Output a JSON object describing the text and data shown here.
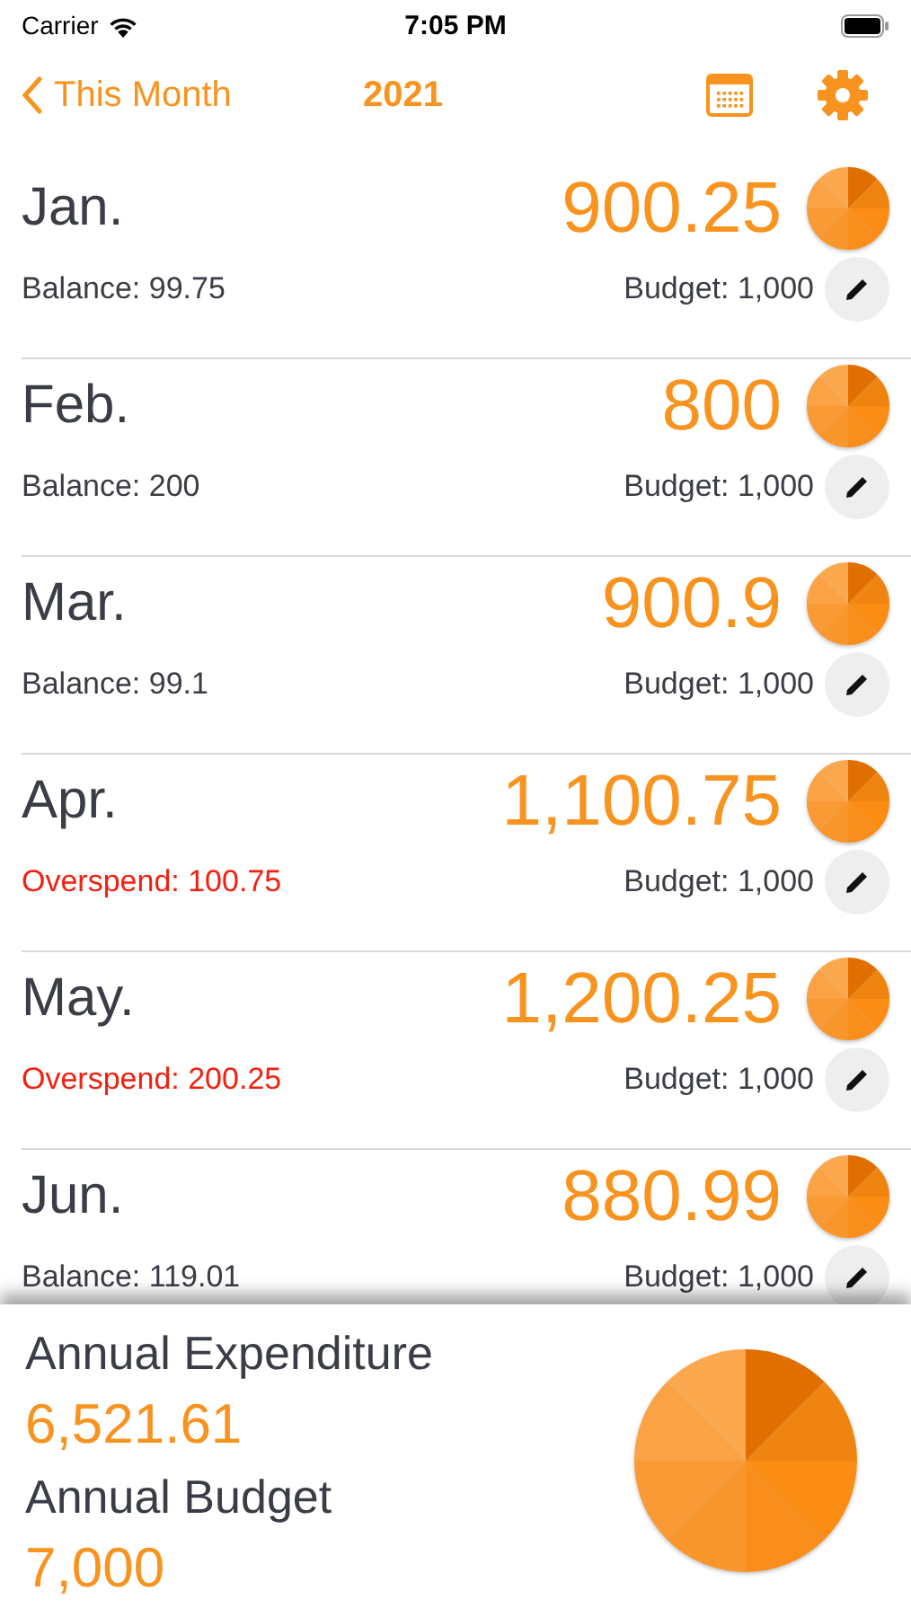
{
  "status_bar": {
    "carrier": "Carrier",
    "time": "7:05 PM"
  },
  "nav": {
    "back_label": "This Month",
    "title": "2021"
  },
  "months": [
    {
      "name": "Jan.",
      "amount": "900.25",
      "overspend": false,
      "status": "Balance: 99.75",
      "budget": "Budget: 1,000"
    },
    {
      "name": "Feb.",
      "amount": "800",
      "overspend": false,
      "status": "Balance: 200",
      "budget": "Budget: 1,000"
    },
    {
      "name": "Mar.",
      "amount": "900.9",
      "overspend": false,
      "status": "Balance: 99.1",
      "budget": "Budget: 1,000"
    },
    {
      "name": "Apr.",
      "amount": "1,100.75",
      "overspend": true,
      "status": "Overspend: 100.75",
      "budget": "Budget: 1,000"
    },
    {
      "name": "May.",
      "amount": "1,200.25",
      "overspend": true,
      "status": "Overspend: 200.25",
      "budget": "Budget: 1,000"
    },
    {
      "name": "Jun.",
      "amount": "880.99",
      "overspend": false,
      "status": "Balance: 119.01",
      "budget": "Budget: 1,000"
    }
  ],
  "summary": {
    "expenditure_label": "Annual Expenditure",
    "expenditure": "6,521.61",
    "budget_label": "Annual Budget",
    "budget": "7,000"
  }
}
